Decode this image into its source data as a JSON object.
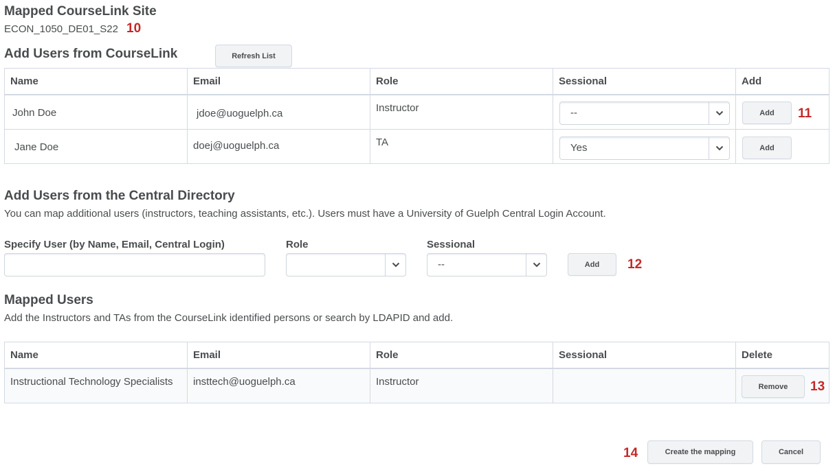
{
  "mapped_site": {
    "title": "Mapped CourseLink Site",
    "course_code": "ECON_1050_DE01_S22",
    "callout": "10"
  },
  "courselink_users": {
    "title": "Add Users from CourseLink",
    "refresh_label": "Refresh List",
    "headers": [
      "Name",
      "Email",
      "Role",
      "Sessional",
      "Add"
    ],
    "rows": [
      {
        "name": "John Doe",
        "email": "jdoe@uoguelph.ca",
        "role": "Instructor",
        "sessional": "--",
        "add_label": "Add"
      },
      {
        "name": "Jane Doe",
        "email": "doej@uoguelph.ca",
        "role": "TA",
        "sessional": "Yes",
        "add_label": "Add"
      }
    ],
    "callout": "11"
  },
  "central_directory": {
    "title": "Add Users from the Central Directory",
    "description": "You can map additional users (instructors, teaching assistants, etc.). Users must have a University of Guelph Central Login Account.",
    "user_label": "Specify User (by Name, Email, Central Login)",
    "user_value": "",
    "role_label": "Role",
    "role_value": "",
    "sessional_label": "Sessional",
    "sessional_value": "--",
    "add_label": "Add",
    "callout": "12"
  },
  "mapped_users": {
    "title": "Mapped Users",
    "description": "Add the Instructors and TAs from the CourseLink identified persons or search by LDAPID and add.",
    "headers": [
      "Name",
      "Email",
      "Role",
      "Sessional",
      "Delete"
    ],
    "rows": [
      {
        "name": "Instructional Technology Specialists",
        "email": "insttech@uoguelph.ca",
        "role": "Instructor",
        "sessional": "",
        "remove_label": "Remove"
      }
    ],
    "callout": "13"
  },
  "footer": {
    "callout": "14",
    "create_label": "Create the mapping",
    "cancel_label": "Cancel"
  },
  "colors": {
    "callout": "#c62828",
    "text": "#494c4e",
    "border": "#d3d9e3",
    "row_alt": "#f9fafb"
  },
  "icons": {
    "select_caret": "chevron-down-icon"
  }
}
